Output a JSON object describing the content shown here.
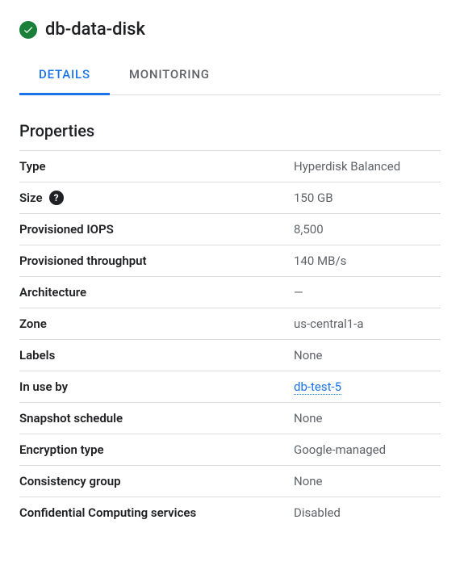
{
  "header": {
    "title": "db-data-disk"
  },
  "tabs": [
    {
      "label": "DETAILS",
      "active": true
    },
    {
      "label": "MONITORING",
      "active": false
    }
  ],
  "section": {
    "title": "Properties"
  },
  "properties": [
    {
      "label": "Type",
      "value": "Hyperdisk Balanced",
      "type": "text"
    },
    {
      "label": "Size",
      "value": "150 GB",
      "type": "text",
      "help": true
    },
    {
      "label": "Provisioned IOPS",
      "value": "8,500",
      "type": "text"
    },
    {
      "label": "Provisioned throughput",
      "value": "140 MB/s",
      "type": "text"
    },
    {
      "label": "Architecture",
      "value": "—",
      "type": "text"
    },
    {
      "label": "Zone",
      "value": "us-central1-a",
      "type": "text"
    },
    {
      "label": "Labels",
      "value": "None",
      "type": "text"
    },
    {
      "label": "In use by",
      "value": "db-test-5",
      "type": "link"
    },
    {
      "label": "Snapshot schedule",
      "value": "None",
      "type": "text"
    },
    {
      "label": "Encryption type",
      "value": "Google-managed",
      "type": "text"
    },
    {
      "label": "Consistency group",
      "value": "None",
      "type": "text"
    },
    {
      "label": "Confidential Computing services",
      "value": "Disabled",
      "type": "text"
    }
  ]
}
